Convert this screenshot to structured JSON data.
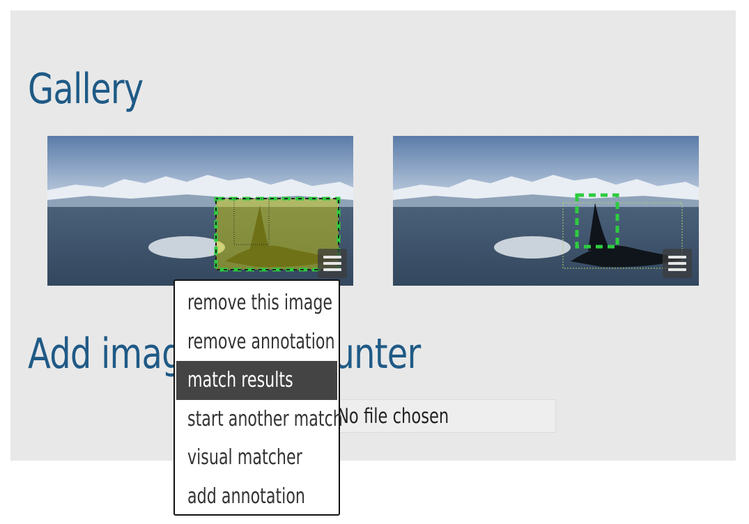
{
  "gallery": {
    "title": "Gallery"
  },
  "add_section": {
    "title": "Add image to encounter"
  },
  "file_input": {
    "status_text": "No file chosen"
  },
  "context_menu": {
    "items": [
      {
        "label": "remove this image"
      },
      {
        "label": "remove annotation"
      },
      {
        "label": "match results",
        "highlighted": true
      },
      {
        "label": "start another match"
      },
      {
        "label": "visual matcher"
      },
      {
        "label": "add annotation"
      }
    ]
  },
  "colors": {
    "heading": "#1f5a86",
    "panel_bg": "#e8e8e8",
    "annotation_green": "#2ecc40",
    "menu_highlight": "#444444"
  }
}
